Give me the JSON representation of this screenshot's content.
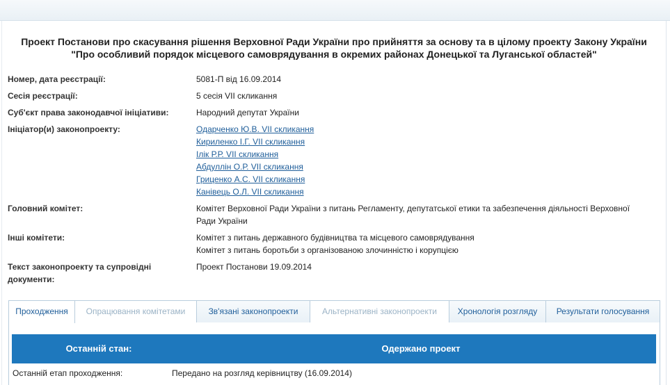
{
  "title": {
    "line1": "Проект Постанови про скасування рішення Верховної Ради України про прийняття за основу та в цілому проекту Закону України",
    "line2": "\"Про особливий порядок місцевого самоврядування в окремих районах Донецької та Луганської областей\""
  },
  "fields": {
    "reg": {
      "label": "Номер, дата реєстрації:",
      "value": "5081-П від 16.09.2014"
    },
    "session": {
      "label": "Сесія реєстрації:",
      "value": "5 сесія VII скликання"
    },
    "subject": {
      "label": "Суб'єкт права законодавчої ініціативи:",
      "value": "Народний депутат України"
    },
    "initiators": {
      "label": "Ініціатор(и) законопроекту:",
      "items": [
        "Одарченко Ю.В. VII скликання",
        "Кириленко І.Г. VII скликання",
        "Ілік Р.Р. VII скликання",
        "Абдуллін О.Р. VII скликання",
        "Гриценко А.С. VII скликання",
        "Канівець О.Л. VII скликання"
      ]
    },
    "main_committee": {
      "label": "Головний комітет:",
      "value": "Комітет Верховної Ради України з питань Регламенту, депутатської етики та забезпечення діяльності Верховної Ради України"
    },
    "other_committees": {
      "label": "Інші комітети:",
      "items": [
        "Комітет з питань державного будівництва та місцевого самоврядування",
        "Комітет з питань боротьби з організованою злочинністю і корупцією"
      ]
    },
    "docs": {
      "label": "Текст законопроекту та супровідні документи:",
      "value": "Проект Постанови 19.09.2014"
    }
  },
  "tabs": [
    {
      "label": "Проходження",
      "state": "active"
    },
    {
      "label": "Опрацювання комітетами",
      "state": "disabled"
    },
    {
      "label": "Зв'язані законопроекти",
      "state": "enabled"
    },
    {
      "label": "Альтернативні законопроекти",
      "state": "disabled"
    },
    {
      "label": "Хронологія розгляду",
      "state": "enabled"
    },
    {
      "label": "Результати голосування",
      "state": "enabled"
    }
  ],
  "status": {
    "label": "Останній стан:",
    "value": "Одержано проект",
    "bar_color": "#1e78bd"
  },
  "stage": {
    "label": "Останній етап проходження:",
    "value": "Передано на розгляд керівництву (16.09.2014)"
  }
}
